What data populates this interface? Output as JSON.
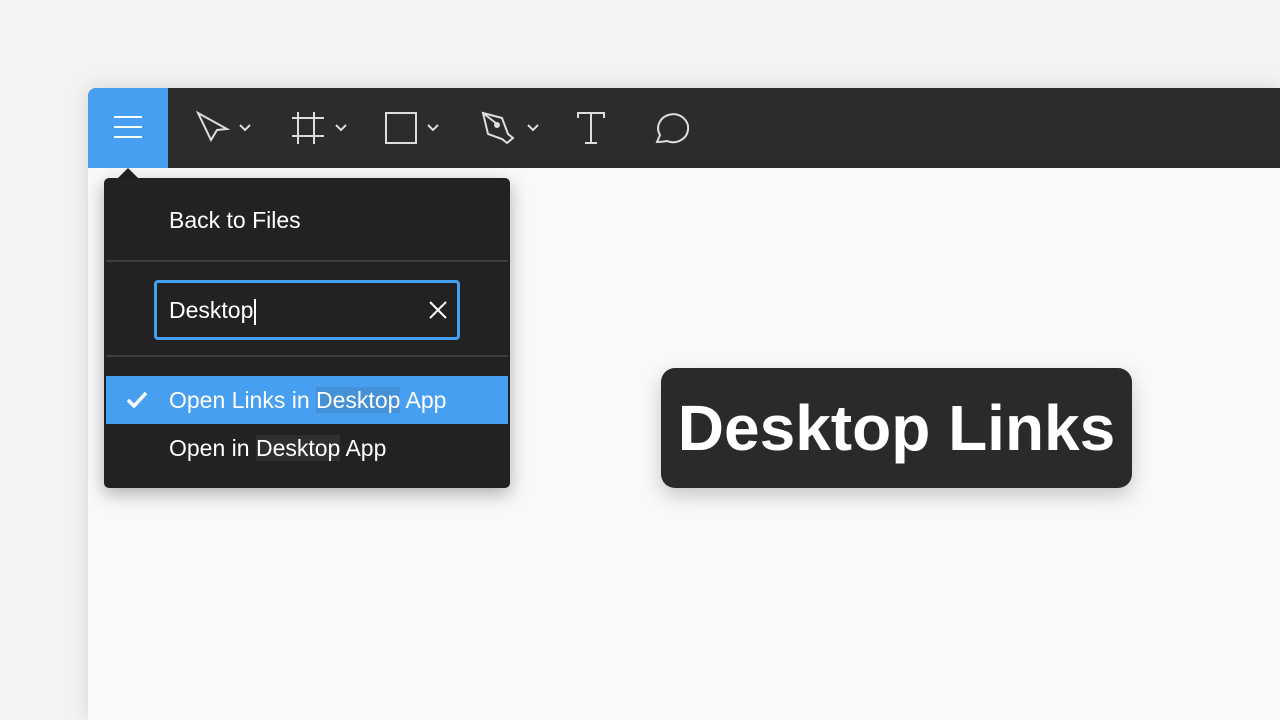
{
  "toolbar": {
    "tools": [
      "menu-icon",
      "move-icon",
      "frame-icon",
      "rectangle-icon",
      "pen-icon",
      "text-icon",
      "comment-icon"
    ],
    "accent": "#479ff2"
  },
  "menu": {
    "back_label": "Back to Files",
    "search_value": "Desktop",
    "items": [
      {
        "before": "Open Links in ",
        "match": "Desktop",
        "after": " App",
        "checked": true
      },
      {
        "before": "Open in ",
        "match": "Desktop",
        "after": " App",
        "checked": false
      }
    ]
  },
  "caption": "Desktop Links"
}
